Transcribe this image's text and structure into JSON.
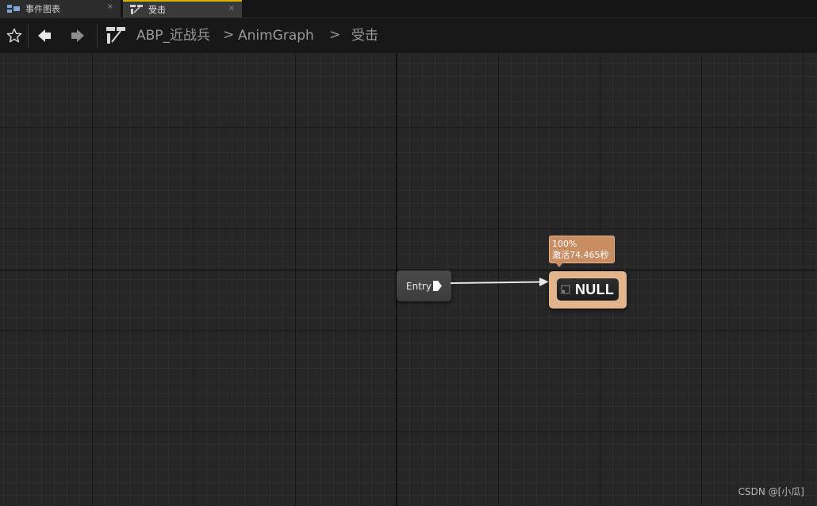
{
  "tabs": [
    {
      "label": "事件图表",
      "icon": "event-graph-icon",
      "active": false
    },
    {
      "label": "受击",
      "icon": "state-machine-icon",
      "active": true
    }
  ],
  "tab_close_glyph": "×",
  "breadcrumb": {
    "items": [
      "ABP_近战兵",
      "AnimGraph",
      "受击"
    ],
    "separator": ">"
  },
  "graph": {
    "entry_node": {
      "label": "Entry"
    },
    "state_node": {
      "label": "NULL",
      "tooltip": {
        "line1": "100%",
        "line2": "激活74.465秒"
      }
    }
  },
  "watermark": "CSDN @[小瓜]",
  "colors": {
    "active_tab_accent": "#d8b200",
    "state_node": "#e3b58c",
    "tooltip": "#c98d64"
  }
}
